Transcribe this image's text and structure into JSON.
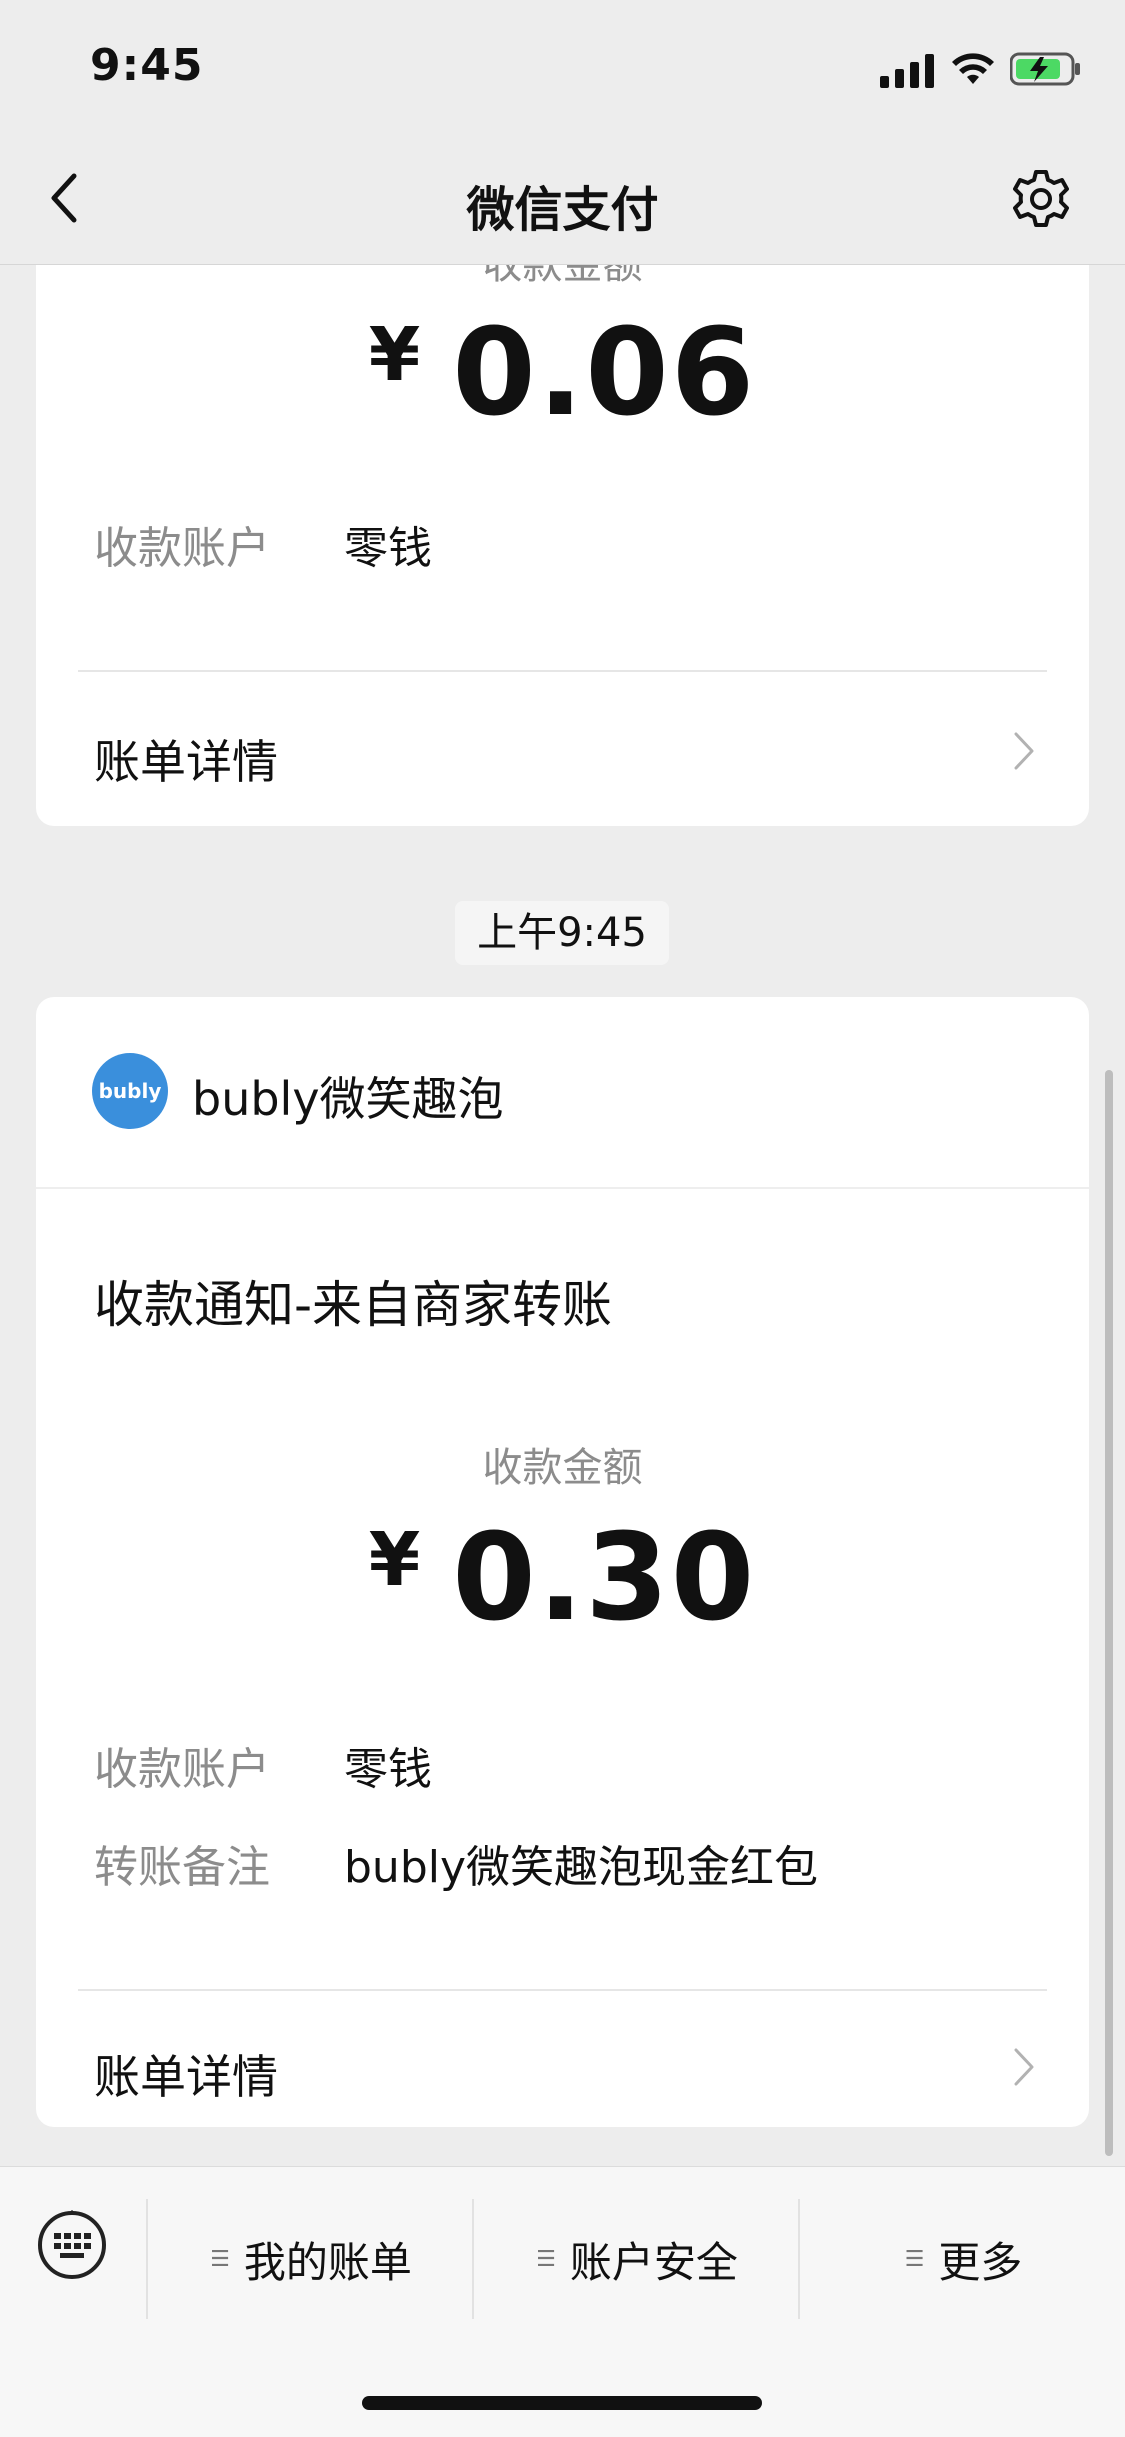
{
  "status_bar": {
    "time": "9:45"
  },
  "nav": {
    "title": "微信支付"
  },
  "card1": {
    "amount_label": "收款金额",
    "currency": "¥",
    "amount": "0.06",
    "account_key": "收款账户",
    "account_value": "零钱",
    "detail_label": "账单详情"
  },
  "timestamp": "上午9:45",
  "card2": {
    "logo_text": "bubly",
    "merchant_name": "bubly微笑趣泡",
    "notice_title": "收款通知-来自商家转账",
    "amount_label": "收款金额",
    "currency": "¥",
    "amount": "0.30",
    "account_key": "收款账户",
    "account_value": "零钱",
    "remark_key": "转账备注",
    "remark_value": "bubly微笑趣泡现金红包",
    "detail_label": "账单详情"
  },
  "bottom_menu": {
    "items": [
      {
        "label": "我的账单"
      },
      {
        "label": "账户安全"
      },
      {
        "label": "更多"
      }
    ]
  },
  "colors": {
    "background": "#ededed",
    "card": "#ffffff",
    "muted_text": "#8c8c8c",
    "logo_blue": "#3a8fdc"
  },
  "icons": [
    "back-chevron-icon",
    "gear-icon",
    "signal-icon",
    "wifi-icon",
    "battery-icon",
    "keyboard-icon",
    "chevron-right-icon",
    "menu-lines-icon"
  ]
}
